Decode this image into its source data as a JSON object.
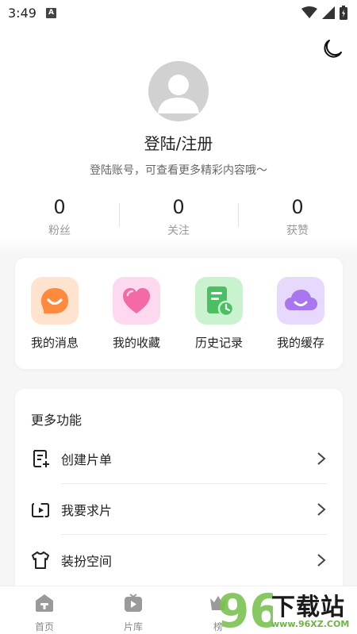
{
  "status_bar": {
    "time": "3:49",
    "notification_badge": "A"
  },
  "profile": {
    "title": "登陆/注册",
    "subtitle": "登陆账号，可查看更多精彩内容哦～"
  },
  "stats": [
    {
      "value": "0",
      "label": "粉丝"
    },
    {
      "value": "0",
      "label": "关注"
    },
    {
      "value": "0",
      "label": "获赞"
    }
  ],
  "quick_actions": [
    {
      "label": "我的消息",
      "icon": "message-icon",
      "color": "#ff8a3d"
    },
    {
      "label": "我的收藏",
      "icon": "heart-icon",
      "color": "#f46aa6"
    },
    {
      "label": "历史记录",
      "icon": "history-icon",
      "color": "#4cbe63"
    },
    {
      "label": "我的缓存",
      "icon": "cloud-icon",
      "color": "#a776f0"
    }
  ],
  "more": {
    "title": "更多功能",
    "items": [
      {
        "label": "创建片单",
        "icon": "create-list-icon"
      },
      {
        "label": "我要求片",
        "icon": "request-video-icon"
      },
      {
        "label": "装扮空间",
        "icon": "dress-up-icon"
      }
    ]
  },
  "nav": [
    {
      "label": "首页",
      "icon": "home-icon"
    },
    {
      "label": "片库",
      "icon": "library-icon"
    },
    {
      "label": "榜",
      "icon": "ranking-icon"
    }
  ],
  "watermark": {
    "number": "96",
    "text": "下载站",
    "url": "www.96XZ.COM"
  }
}
